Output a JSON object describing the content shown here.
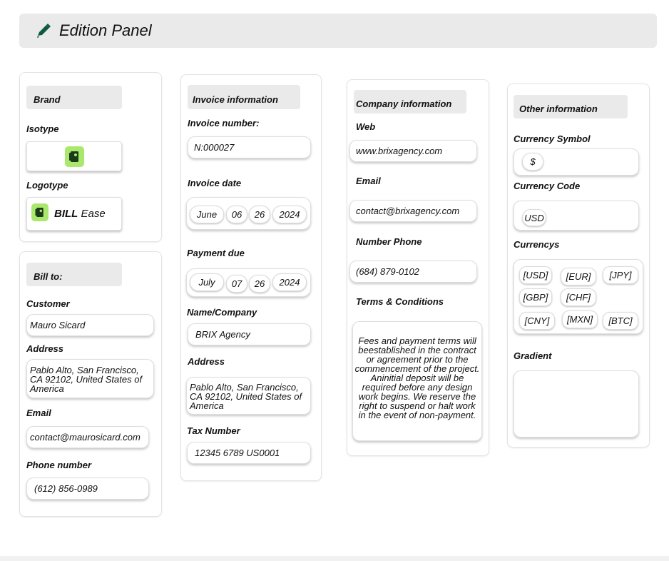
{
  "header": {
    "title": "Edition Panel",
    "icon": "pencil-icon"
  },
  "brand": {
    "section_title": "Brand",
    "isotype_label": "Isotype",
    "logotype_label": "Logotype",
    "logo_bold": "BILL",
    "logo_light": "Ease",
    "accent_color": "#a9e86d"
  },
  "bill_to": {
    "section_title": "Bill to:",
    "customer_label": "Customer",
    "customer_value": "Mauro Sicard",
    "address_label": "Address",
    "address_value": "Pablo Alto, San Francisco, CA 92102, United States of America",
    "email_label": "Email",
    "email_value": "contact@maurosicard.com",
    "phone_label": "Phone number",
    "phone_value": "(612) 856-0989"
  },
  "invoice": {
    "section_title": "Invoice information",
    "number_label": "Invoice number:",
    "number_value": "N:000027",
    "date_label": "Invoice date",
    "date": {
      "month": "June",
      "day": "06",
      "day2": "26",
      "year": "2024"
    },
    "due_label": "Payment due",
    "due": {
      "month": "July",
      "day": "07",
      "day2": "26",
      "year": "2024"
    },
    "name_label": "Name/Company",
    "name_value": "BRIX Agency",
    "address_label": "Address",
    "address_value": "Pablo Alto, San Francisco, CA 92102, United States of America",
    "tax_label": "Tax Number",
    "tax_value": "12345 6789 US0001"
  },
  "company": {
    "section_title": "Company information",
    "web_label": "Web",
    "web_value": "www.brixagency.com",
    "email_label": "Email",
    "email_value": "contact@brixagency.com",
    "phone_label": "Number Phone",
    "phone_value": "(684) 879-0102",
    "terms_label": "Terms & Conditions",
    "terms_value": "Fees and payment terms will beestablished in the contract or agreement prior to the commencement of the project. Aninitial deposit will be required before any design work begins. We reserve the right to suspend or halt work in the event of non-payment."
  },
  "other": {
    "section_title": "Other information",
    "symbol_label": "Currency Symbol",
    "symbol_value": "$",
    "code_label": "Currency Code",
    "code_value": "USD",
    "currencys_label": "Currencys",
    "currencies": [
      "[USD]",
      "[EUR]",
      "[JPY]",
      "[GBP]",
      "[CHF]",
      "[CNY]",
      "[MXN]",
      "[BTC]"
    ],
    "gradient_label": "Gradient"
  }
}
